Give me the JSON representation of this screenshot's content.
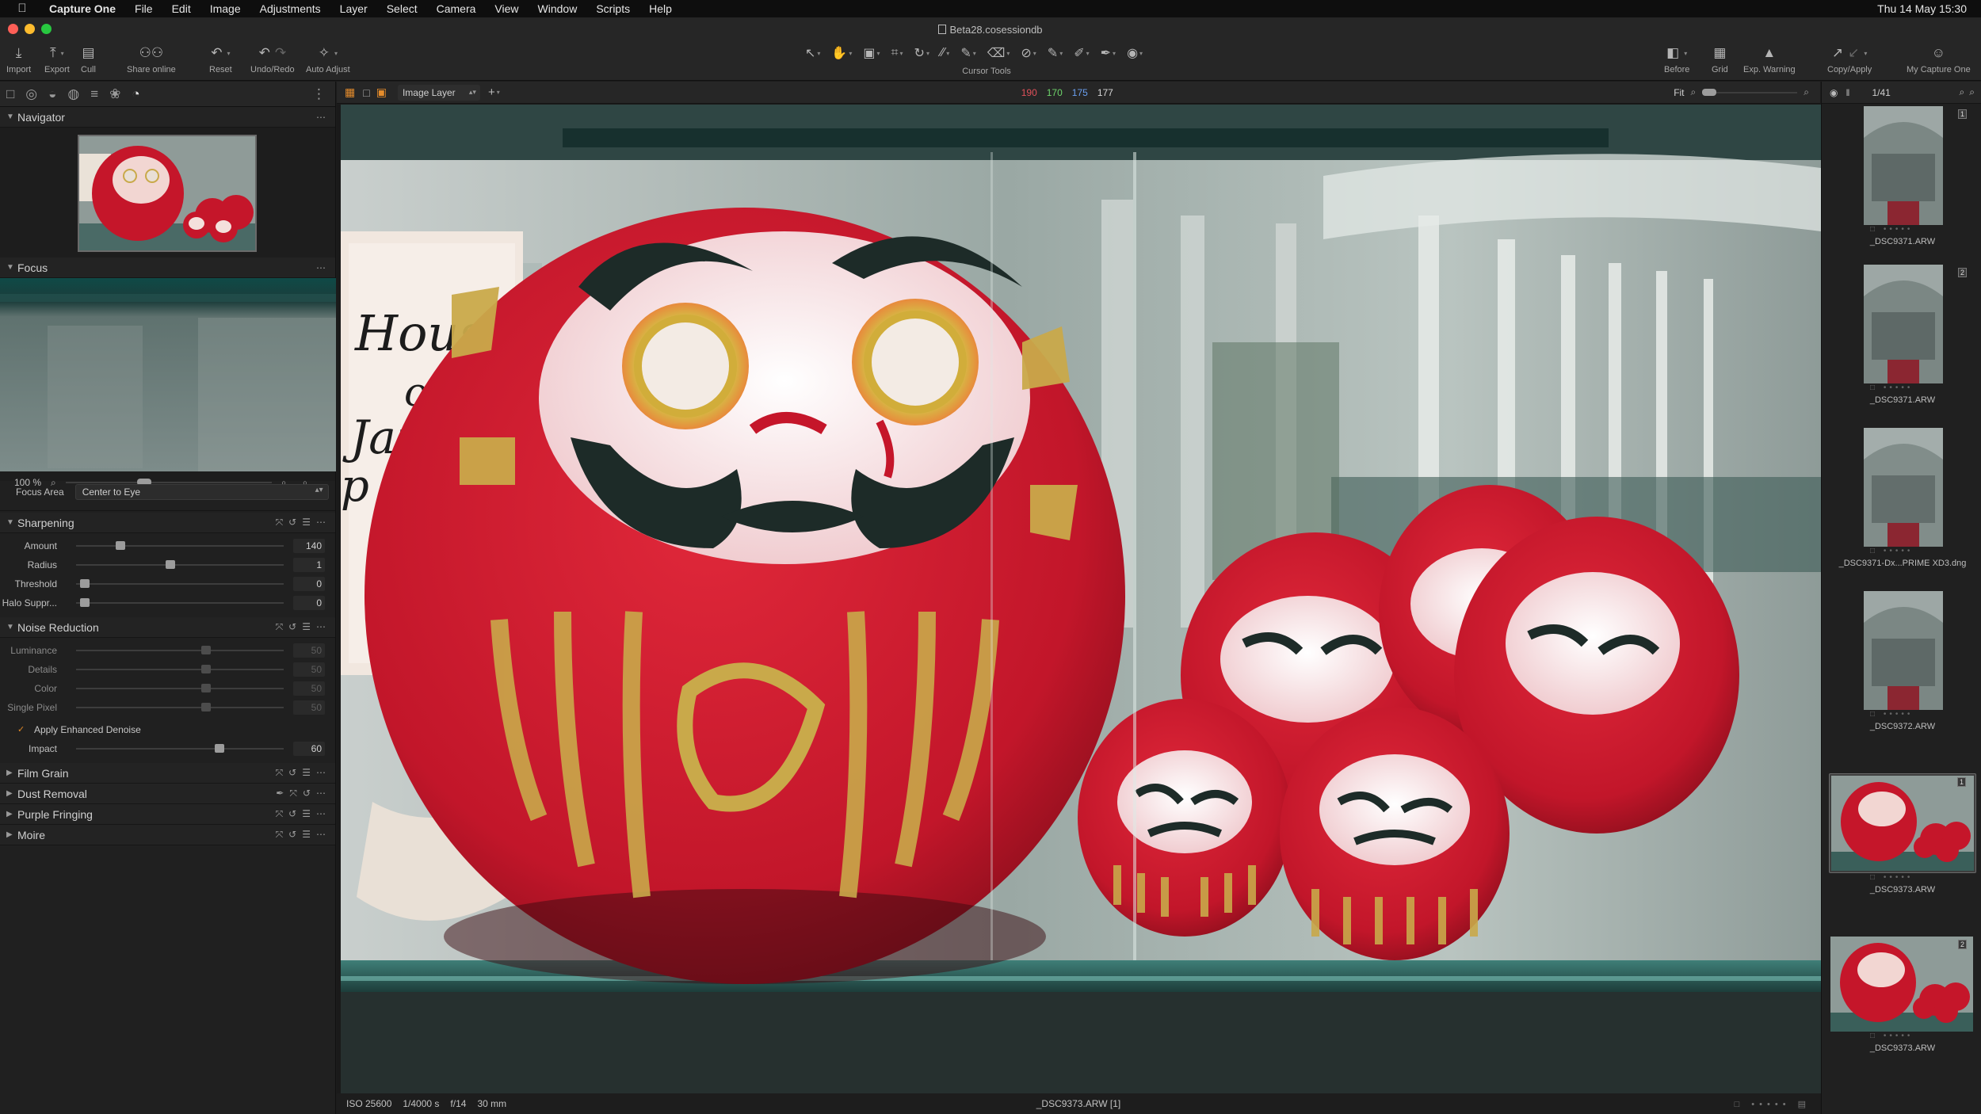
{
  "menubar": {
    "app_name": "Capture One",
    "items": [
      "File",
      "Edit",
      "Image",
      "Adjustments",
      "Layer",
      "Select",
      "Camera",
      "View",
      "Window",
      "Scripts",
      "Help"
    ],
    "clock": "Thu 14 May  15:30"
  },
  "window": {
    "title": "Beta28.cosessiondb"
  },
  "toolbar": {
    "import": "Import",
    "export": "Export",
    "cull": "Cull",
    "share": "Share online",
    "reset": "Reset",
    "undo_redo": "Undo/Redo",
    "auto_adjust": "Auto Adjust",
    "cursor_tools": "Cursor Tools",
    "before": "Before",
    "grid": "Grid",
    "exp_warning": "Exp. Warning",
    "copy_apply": "Copy/Apply",
    "my_capture_one": "My Capture One"
  },
  "viewer_bar": {
    "layer": "Image Layer",
    "rgb": {
      "r": "190",
      "g": "170",
      "b": "175",
      "a": "177"
    },
    "fit": "Fit",
    "counter": "1/41"
  },
  "navigator": {
    "title": "Navigator"
  },
  "focus": {
    "title": "Focus",
    "zoom": "100 %",
    "area_label": "Focus Area",
    "area_value": "Center to Eye"
  },
  "sharpening": {
    "title": "Sharpening",
    "sliders": [
      {
        "label": "Amount",
        "value": "140",
        "pct": 0.2
      },
      {
        "label": "Radius",
        "value": "1",
        "pct": 0.45
      },
      {
        "label": "Threshold",
        "value": "0",
        "pct": 0.02
      },
      {
        "label": "Halo Suppr...",
        "value": "0",
        "pct": 0.02
      }
    ]
  },
  "noise_reduction": {
    "title": "Noise Reduction",
    "sliders": [
      {
        "label": "Luminance",
        "value": "50",
        "pct": 0.63
      },
      {
        "label": "Details",
        "value": "50",
        "pct": 0.63
      },
      {
        "label": "Color",
        "value": "50",
        "pct": 0.63
      },
      {
        "label": "Single Pixel",
        "value": "50",
        "pct": 0.63
      }
    ],
    "enhanced_label": "Apply Enhanced Denoise",
    "impact_label": "Impact",
    "impact_value": "60",
    "impact_pct": 0.7
  },
  "collapsed_sections": [
    "Film Grain",
    "Dust Removal",
    "Purple Fringing",
    "Moire"
  ],
  "photo_text": {
    "sign_lines": [
      "House",
      "of",
      "Japan",
      "p Floor"
    ]
  },
  "status": {
    "iso": "ISO 25600",
    "shutter": "1/4000 s",
    "aperture": "f/14",
    "focal": "30 mm",
    "filename": "_DSC9373.ARW [1]"
  },
  "browser": {
    "thumbs": [
      {
        "name": "_DSC9371.ARW",
        "badge": "1",
        "variant": "hall"
      },
      {
        "name": "_DSC9371.ARW",
        "badge": "2",
        "variant": "hall"
      },
      {
        "name": "_DSC9371-Dx...PRIME XD3.dng",
        "badge": "",
        "variant": "hall"
      },
      {
        "name": "_DSC9372.ARW",
        "badge": "",
        "variant": "hall"
      },
      {
        "name": "_DSC9373.ARW",
        "badge": "1",
        "variant": "daruma"
      },
      {
        "name": "_DSC9373.ARW",
        "badge": "2",
        "variant": "daruma"
      }
    ]
  },
  "colors": {
    "accent": "#e48c2c",
    "daruma_red": "#c5162a",
    "gold": "#c9a94a"
  }
}
